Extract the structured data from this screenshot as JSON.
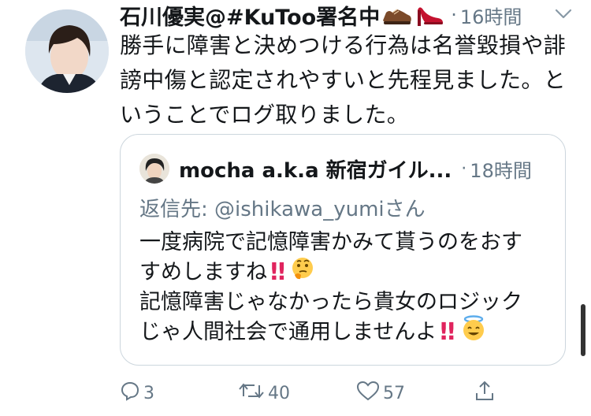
{
  "tweet": {
    "author_name": "石川優実@#KuToo署名中",
    "separator": "·",
    "timestamp": "16時間",
    "text_lines": [
      "勝手に障害と決めつける行為は名誉毀損や誹",
      "謗中傷と認定されやすいと先程見ました。と",
      "いうことでログ取りました。"
    ],
    "emoji_icons": [
      "mans-shoe-icon",
      "high-heel-icon"
    ]
  },
  "quote": {
    "author_name": "mocha a.k.a 新宿ガイル...",
    "separator": "·",
    "timestamp": "18時間",
    "reply_to": "返信先: @ishikawa_yumiさん",
    "lines": [
      {
        "text": "一度病院で記憶障害かみて貰うのをおす",
        "suffix": ""
      },
      {
        "text": "すめしますね",
        "suffix": "!!",
        "emoji": "thinking-face-icon"
      },
      {
        "text": "記憶障害じゃなかったら貴女のロジック",
        "suffix": ""
      },
      {
        "text": "じゃ人間社会で通用しませんよ",
        "suffix": "!!",
        "emoji": "smiling-face-with-halo-icon"
      }
    ]
  },
  "actions": {
    "reply_count": "3",
    "retweet_count": "40",
    "like_count": "57"
  },
  "colors": {
    "text": "#14171a",
    "muted": "#657786",
    "border": "#ccd6dd",
    "exclamation": "#e0245e"
  }
}
